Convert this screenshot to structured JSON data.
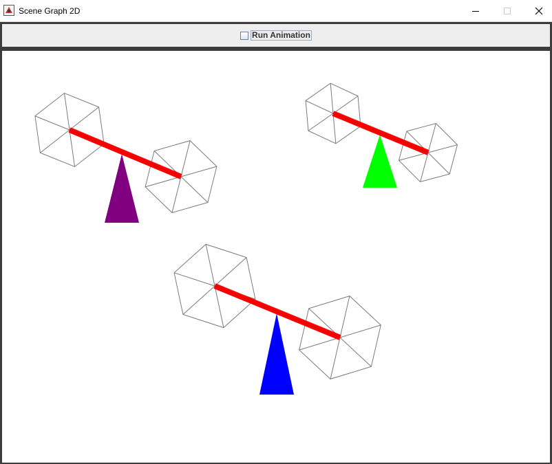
{
  "window": {
    "title": "Scene Graph 2D",
    "icon": "java-app-icon",
    "controls": [
      "minimize-icon",
      "maximize-icon",
      "close-icon"
    ]
  },
  "toolbar": {
    "checkbox": {
      "label": "Run Animation",
      "checked": false
    }
  },
  "colors": {
    "beam": "#ff0000",
    "wheel_stroke": "#7a7a7a",
    "fulcrums": [
      "#800080",
      "#00ff00",
      "#0000ff"
    ]
  },
  "scene": {
    "seesaws": [
      {
        "name": "purple-seesaw",
        "fulcrum_color": "#800080"
      },
      {
        "name": "green-seesaw",
        "fulcrum_color": "#00ff00"
      },
      {
        "name": "blue-seesaw",
        "fulcrum_color": "#0000ff"
      }
    ]
  }
}
